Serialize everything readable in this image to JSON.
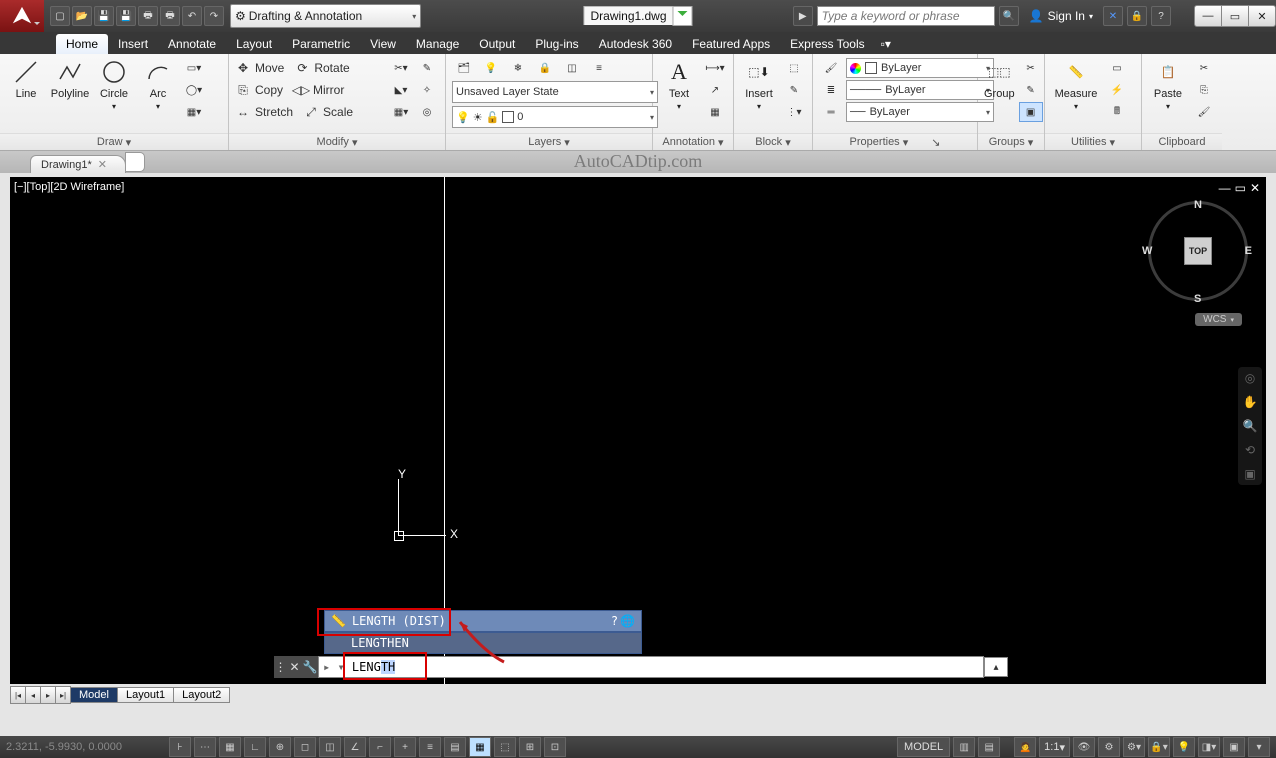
{
  "title_bar": {
    "file": "Drawing1.dwg",
    "workspace": "Drafting & Annotation",
    "search_placeholder": "Type a keyword or phrase",
    "sign_in": "Sign In"
  },
  "tabs": [
    "Home",
    "Insert",
    "Annotate",
    "Layout",
    "Parametric",
    "View",
    "Manage",
    "Output",
    "Plug-ins",
    "Autodesk 360",
    "Featured Apps",
    "Express Tools"
  ],
  "active_tab": "Home",
  "ribbon": {
    "draw": {
      "title": "Draw",
      "tools": {
        "line": "Line",
        "polyline": "Polyline",
        "circle": "Circle",
        "arc": "Arc"
      }
    },
    "modify": {
      "title": "Modify",
      "tools": {
        "move": "Move",
        "rotate": "Rotate",
        "copy": "Copy",
        "mirror": "Mirror",
        "stretch": "Stretch",
        "scale": "Scale"
      }
    },
    "layers": {
      "title": "Layers",
      "state": "Unsaved Layer State",
      "current": "0"
    },
    "annotation": {
      "title": "Annotation",
      "text": "Text"
    },
    "block": {
      "title": "Block",
      "insert": "Insert"
    },
    "properties": {
      "title": "Properties",
      "color": "ByLayer",
      "ltype": "ByLayer",
      "lweight": "ByLayer"
    },
    "groups": {
      "title": "Groups",
      "btn": "Group"
    },
    "utilities": {
      "title": "Utilities",
      "btn": "Measure"
    },
    "clipboard": {
      "title": "Clipboard",
      "btn": "Paste"
    }
  },
  "doc_tab": "Drawing1*",
  "watermark": "AutoCADtip.com",
  "viewport_label": "[−][Top][2D Wireframe]",
  "viewcube": {
    "face": "TOP",
    "n": "N",
    "e": "E",
    "s": "S",
    "w": "W"
  },
  "wcs": "WCS",
  "suggest": {
    "item1": "LENGTH (DIST)",
    "item2": "LENGTHEN"
  },
  "cmd": {
    "prefix": "▸ ",
    "typed": "LENG",
    "selected": "TH"
  },
  "layout_tabs": {
    "model": "Model",
    "l1": "Layout1",
    "l2": "Layout2"
  },
  "status": {
    "coords": "2.3211, -5.9930, 0.0000",
    "model": "MODEL",
    "scale": "1:1"
  }
}
